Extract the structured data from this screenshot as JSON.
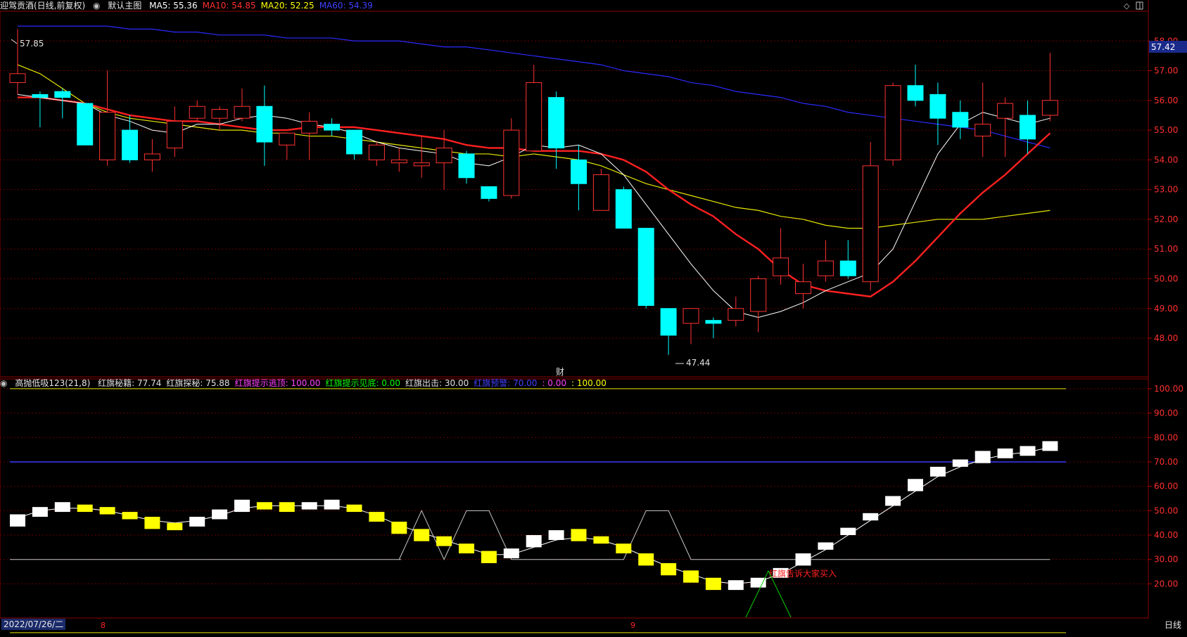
{
  "header": {
    "stock": "迎驾贡酒(日线,前复权)",
    "main_label": "默认主图",
    "ma": [
      {
        "label": "MA5: 55.36",
        "color": "#ffffff"
      },
      {
        "label": "MA10: 54.85",
        "color": "#ff3030"
      },
      {
        "label": "MA20: 52.25",
        "color": "#ffff00"
      },
      {
        "label": "MA60: 54.39",
        "color": "#4040ff"
      }
    ]
  },
  "indicator_header": {
    "name": "高抛低吸123(21,8)",
    "items": [
      {
        "label": "红旗秘籍: 77.74",
        "color": "#e0e0e0"
      },
      {
        "label": "红旗探秘: 75.88",
        "color": "#e0e0e0"
      },
      {
        "label": "红旗提示逃顶: 100.00",
        "color": "#ff40ff"
      },
      {
        "label": "红旗提示见底: 0.00",
        "color": "#00ff00"
      },
      {
        "label": "红旗出击: 30.00",
        "color": "#e0e0e0"
      },
      {
        "label": "红旗预警: 70.00",
        "color": "#4040ff"
      },
      {
        "label": ": 0.00",
        "color": "#ff40ff"
      },
      {
        "label": ": 100.00",
        "color": "#ffff00"
      }
    ]
  },
  "price_axis": {
    "labels": [
      "58.00",
      "57.00",
      "56.00",
      "55.00",
      "54.00",
      "53.00",
      "52.00",
      "51.00",
      "50.00",
      "49.00",
      "48.00"
    ],
    "current": "57.42"
  },
  "indicator_axis": {
    "labels": [
      "100.00",
      "90.00",
      "80.00",
      "70.00",
      "60.00",
      "50.00",
      "40.00",
      "30.00",
      "20.00"
    ]
  },
  "annotations": {
    "high": "57.85",
    "low": "47.44",
    "cai": "财",
    "buy_text": "红旗告诉大家买入"
  },
  "candles": [
    {
      "o": 56.6,
      "c": 56.9,
      "h": 58.4,
      "l": 56.2
    },
    {
      "o": 56.2,
      "c": 56.1,
      "h": 56.3,
      "l": 55.1
    },
    {
      "o": 56.3,
      "c": 56.1,
      "h": 56.4,
      "l": 55.4
    },
    {
      "o": 55.9,
      "c": 54.5,
      "h": 55.9,
      "l": 54.5
    },
    {
      "o": 54.0,
      "c": 55.6,
      "h": 57.0,
      "l": 53.8
    },
    {
      "o": 55.0,
      "c": 54.0,
      "h": 55.5,
      "l": 53.9
    },
    {
      "o": 54.0,
      "c": 54.2,
      "h": 54.7,
      "l": 53.6
    },
    {
      "o": 54.4,
      "c": 55.3,
      "h": 55.8,
      "l": 54.1
    },
    {
      "o": 55.4,
      "c": 55.8,
      "h": 56.0,
      "l": 55.3
    },
    {
      "o": 55.4,
      "c": 55.7,
      "h": 55.8,
      "l": 55.0
    },
    {
      "o": 55.4,
      "c": 55.8,
      "h": 56.4,
      "l": 55.3
    },
    {
      "o": 55.8,
      "c": 54.6,
      "h": 56.5,
      "l": 53.8
    },
    {
      "o": 54.5,
      "c": 54.9,
      "h": 54.9,
      "l": 54.0
    },
    {
      "o": 54.9,
      "c": 55.3,
      "h": 55.6,
      "l": 54.0
    },
    {
      "o": 55.2,
      "c": 55.0,
      "h": 55.4,
      "l": 54.8
    },
    {
      "o": 55.0,
      "c": 54.2,
      "h": 55.0,
      "l": 54.0
    },
    {
      "o": 54.0,
      "c": 54.5,
      "h": 54.6,
      "l": 53.8
    },
    {
      "o": 53.9,
      "c": 54.0,
      "h": 54.4,
      "l": 53.6
    },
    {
      "o": 53.8,
      "c": 53.9,
      "h": 54.8,
      "l": 53.4
    },
    {
      "o": 53.9,
      "c": 54.4,
      "h": 55.0,
      "l": 53.0
    },
    {
      "o": 54.2,
      "c": 53.4,
      "h": 54.3,
      "l": 53.2
    },
    {
      "o": 53.1,
      "c": 52.7,
      "h": 53.1,
      "l": 52.6
    },
    {
      "o": 52.8,
      "c": 55.0,
      "h": 55.4,
      "l": 52.7
    },
    {
      "o": 54.3,
      "c": 56.6,
      "h": 57.2,
      "l": 54.3
    },
    {
      "o": 56.1,
      "c": 54.4,
      "h": 56.3,
      "l": 53.7
    },
    {
      "o": 54.0,
      "c": 53.2,
      "h": 54.5,
      "l": 52.3
    },
    {
      "o": 52.3,
      "c": 53.5,
      "h": 53.7,
      "l": 52.3
    },
    {
      "o": 53.0,
      "c": 51.7,
      "h": 53.1,
      "l": 51.7
    },
    {
      "o": 51.7,
      "c": 49.1,
      "h": 51.7,
      "l": 49.0
    },
    {
      "o": 49.0,
      "c": 48.1,
      "h": 49.0,
      "l": 47.44
    },
    {
      "o": 48.5,
      "c": 49.0,
      "h": 49.0,
      "l": 47.8
    },
    {
      "o": 48.6,
      "c": 48.5,
      "h": 48.7,
      "l": 48.0
    },
    {
      "o": 48.6,
      "c": 49.0,
      "h": 49.4,
      "l": 48.4
    },
    {
      "o": 48.9,
      "c": 50.0,
      "h": 50.1,
      "l": 48.2
    },
    {
      "o": 50.1,
      "c": 50.7,
      "h": 51.7,
      "l": 49.8
    },
    {
      "o": 49.5,
      "c": 49.9,
      "h": 50.5,
      "l": 49.0
    },
    {
      "o": 50.1,
      "c": 50.6,
      "h": 51.3,
      "l": 49.9
    },
    {
      "o": 50.6,
      "c": 50.1,
      "h": 51.3,
      "l": 50.0
    },
    {
      "o": 49.9,
      "c": 53.8,
      "h": 54.6,
      "l": 49.6
    },
    {
      "o": 54.0,
      "c": 56.5,
      "h": 56.6,
      "l": 53.8
    },
    {
      "o": 56.5,
      "c": 56.0,
      "h": 57.2,
      "l": 55.8
    },
    {
      "o": 56.2,
      "c": 55.4,
      "h": 56.6,
      "l": 54.5
    },
    {
      "o": 55.6,
      "c": 55.1,
      "h": 56.0,
      "l": 54.7
    },
    {
      "o": 54.8,
      "c": 55.2,
      "h": 56.6,
      "l": 54.1
    },
    {
      "o": 55.4,
      "c": 55.9,
      "h": 56.1,
      "l": 54.1
    },
    {
      "o": 55.5,
      "c": 54.7,
      "h": 56.0,
      "l": 54.2
    },
    {
      "o": 55.5,
      "c": 56.0,
      "h": 57.6,
      "l": 55.3
    }
  ],
  "ma5": [
    56.2,
    56.1,
    56.0,
    55.9,
    55.5,
    55.3,
    55.0,
    54.9,
    55.2,
    55.2,
    55.4,
    55.5,
    55.4,
    55.2,
    55.1,
    54.9,
    54.6,
    54.4,
    54.3,
    54.2,
    53.9,
    53.8,
    54.1,
    54.5,
    54.4,
    54.5,
    54.2,
    53.5,
    52.5,
    51.5,
    50.5,
    49.6,
    48.9,
    48.7,
    48.9,
    49.2,
    49.6,
    49.9,
    50.2,
    51.0,
    52.6,
    54.2,
    55.2,
    55.6,
    55.4,
    55.2,
    55.4
  ],
  "ma10": [
    56.1,
    56.1,
    56.0,
    55.9,
    55.7,
    55.5,
    55.4,
    55.3,
    55.3,
    55.2,
    55.1,
    55.0,
    55.0,
    55.1,
    55.1,
    55.1,
    55.0,
    54.9,
    54.8,
    54.7,
    54.5,
    54.4,
    54.4,
    54.3,
    54.3,
    54.3,
    54.2,
    54.0,
    53.6,
    53.0,
    52.5,
    52.1,
    51.5,
    51.0,
    50.3,
    49.8,
    49.6,
    49.5,
    49.4,
    49.9,
    50.6,
    51.4,
    52.2,
    52.9,
    53.5,
    54.2,
    54.9
  ],
  "ma20": [
    57.2,
    56.9,
    56.4,
    55.9,
    55.6,
    55.4,
    55.3,
    55.2,
    55.1,
    55.0,
    55.0,
    54.9,
    54.9,
    54.8,
    54.8,
    54.7,
    54.6,
    54.5,
    54.4,
    54.3,
    54.2,
    54.2,
    54.1,
    54.2,
    54.1,
    54.0,
    53.8,
    53.5,
    53.2,
    53.0,
    52.8,
    52.6,
    52.4,
    52.3,
    52.1,
    52.0,
    51.8,
    51.7,
    51.7,
    51.8,
    51.9,
    52.0,
    52.0,
    52.0,
    52.1,
    52.2,
    52.3
  ],
  "ma60": [
    58.5,
    58.5,
    58.5,
    58.5,
    58.5,
    58.4,
    58.4,
    58.3,
    58.3,
    58.2,
    58.2,
    58.2,
    58.1,
    58.1,
    58.1,
    58.0,
    58.0,
    58.0,
    57.9,
    57.8,
    57.8,
    57.7,
    57.6,
    57.5,
    57.4,
    57.3,
    57.2,
    57.0,
    56.9,
    56.8,
    56.6,
    56.5,
    56.3,
    56.2,
    56.1,
    55.9,
    55.8,
    55.6,
    55.5,
    55.4,
    55.3,
    55.2,
    55.1,
    55.0,
    54.8,
    54.6,
    54.4
  ],
  "osc": [
    45,
    49,
    52,
    51,
    50,
    48,
    44,
    42,
    45,
    49,
    53,
    52,
    51,
    52,
    53,
    51,
    47,
    42,
    39,
    37,
    34,
    30,
    33,
    40,
    42,
    41,
    38,
    34,
    29,
    25,
    22,
    19,
    19,
    20,
    25,
    31,
    37,
    43,
    49,
    56,
    63,
    68,
    71,
    73,
    74,
    75,
    77
  ],
  "osc_signal": [
    47,
    50,
    51,
    51,
    50,
    48,
    46,
    45,
    46,
    48,
    51,
    52,
    52,
    52,
    52,
    51,
    48,
    44,
    41,
    38,
    35,
    32,
    32,
    35,
    38,
    39,
    38,
    35,
    31,
    27,
    24,
    21,
    20,
    21,
    24,
    29,
    34,
    40,
    46,
    52,
    58,
    64,
    68,
    71,
    73,
    74,
    76
  ],
  "osc_gray": [
    null,
    null,
    null,
    null,
    null,
    null,
    null,
    null,
    null,
    null,
    null,
    null,
    null,
    null,
    null,
    null,
    null,
    30,
    50,
    30,
    50,
    50,
    30,
    30,
    30,
    30,
    30,
    30,
    50,
    50,
    30,
    30,
    30,
    30,
    30,
    30,
    30,
    30,
    30,
    30,
    30,
    30,
    30,
    30,
    30,
    30,
    30
  ],
  "osc_ylim": [
    6,
    104
  ],
  "price_ylim": [
    46.7,
    59.0
  ]
}
